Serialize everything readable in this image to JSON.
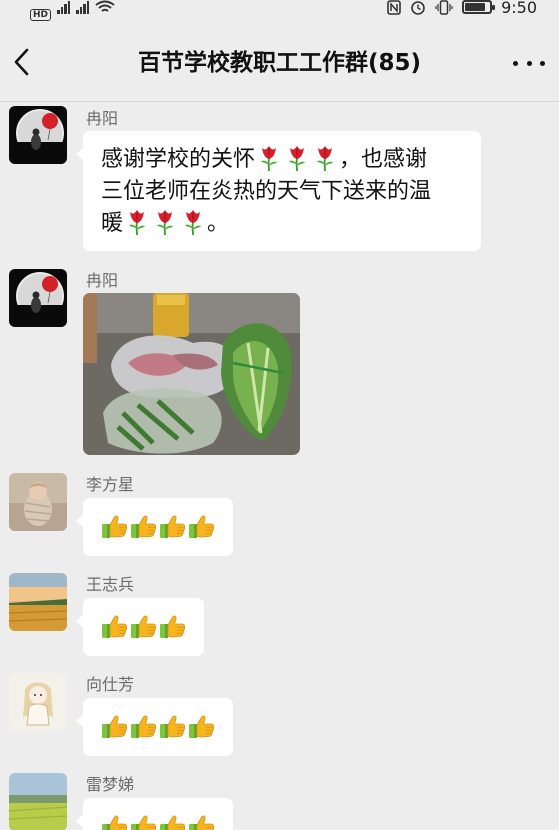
{
  "status_bar": {
    "hd_label": "HD",
    "time": "9:50",
    "icons": [
      "hd-icon",
      "signal-icon",
      "wifi-icon",
      "nfc-icon",
      "alarm-icon",
      "vibrate-icon",
      "battery-icon"
    ]
  },
  "header": {
    "title": "百节学校教职工工作群(85)",
    "back_icon": "chevron-left-icon",
    "more_icon": "more-dots-icon"
  },
  "messages": [
    {
      "sender": "冉阳",
      "type": "text",
      "line1": "感谢学校的关怀",
      "line1_after": "，也感谢",
      "line2": "三位老师在炎热的天气下送来的温",
      "line3": "暖",
      "line3_after": "。",
      "emoji": "tulip"
    },
    {
      "sender": "冉阳",
      "type": "image",
      "image_desc": "photo"
    },
    {
      "sender": "李方星",
      "type": "emoji",
      "emoji": "thumbs-up",
      "count": 4
    },
    {
      "sender": "王志兵",
      "type": "emoji",
      "emoji": "thumbs-up",
      "count": 3
    },
    {
      "sender": "向仕芳",
      "type": "emoji",
      "emoji": "thumbs-up",
      "count": 4
    },
    {
      "sender": "雷梦娣",
      "type": "emoji",
      "emoji": "thumbs-up",
      "count": 4
    }
  ],
  "colors": {
    "background": "#ededed",
    "bubble": "#ffffff",
    "sender_name": "#6b6b6b",
    "thumb_yellow": "#f6b51e",
    "sleeve_green": "#7ec53b",
    "tulip_red": "#d9202a"
  }
}
